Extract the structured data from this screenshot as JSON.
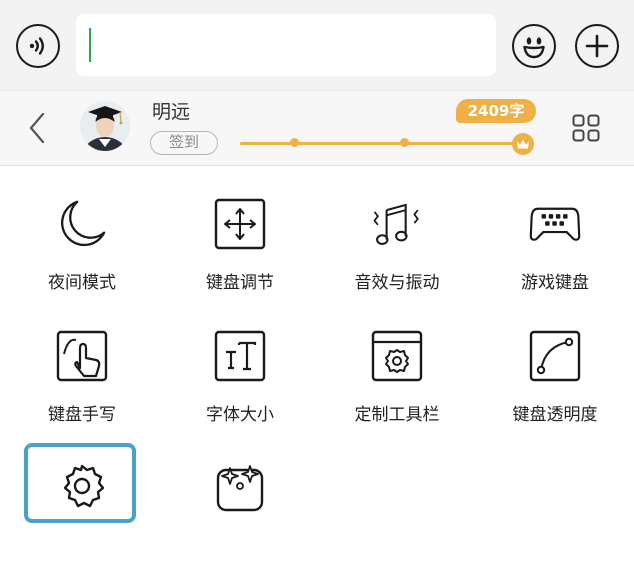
{
  "colors": {
    "accent": "#f0b048",
    "caret": "#2ea84a",
    "selection": "#4aa3c4",
    "icon": "#1a1a1a"
  },
  "input": {
    "value": "",
    "placeholder": ""
  },
  "top_icons": {
    "voice": "voice-icon",
    "emoji": "emoji-icon",
    "plus": "plus-icon"
  },
  "user": {
    "name": "明远",
    "signin_label": "签到",
    "word_count_label": "2409字",
    "progress_fraction": 0.95
  },
  "features": [
    {
      "label": "夜间模式",
      "icon": "moon-icon"
    },
    {
      "label": "键盘调节",
      "icon": "move-arrows-icon"
    },
    {
      "label": "音效与振动",
      "icon": "music-note-icon"
    },
    {
      "label": "游戏键盘",
      "icon": "gamepad-icon"
    },
    {
      "label": "键盘手写",
      "icon": "handwriting-icon"
    },
    {
      "label": "字体大小",
      "icon": "font-size-icon"
    },
    {
      "label": "定制工具栏",
      "icon": "toolbar-gear-icon"
    },
    {
      "label": "键盘透明度",
      "icon": "transparency-curve-icon"
    },
    {
      "label": "",
      "icon": "settings-gear-icon"
    },
    {
      "label": "",
      "icon": "sparkle-skin-icon"
    }
  ]
}
